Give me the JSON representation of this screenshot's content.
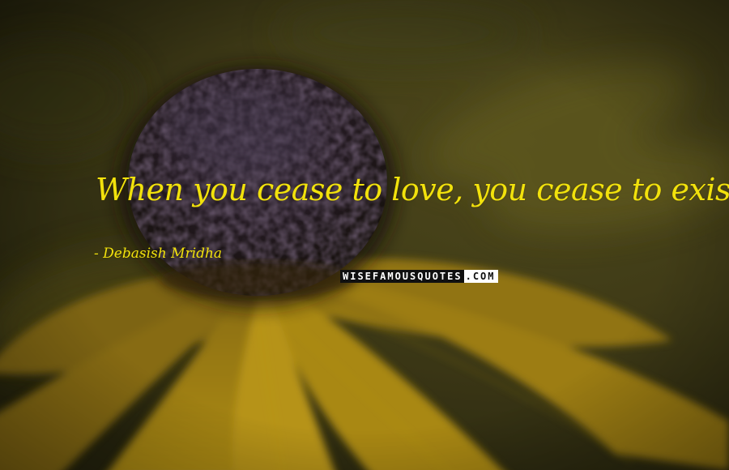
{
  "quote": {
    "text": "When you cease to love, you cease to exist.",
    "author": "- Debasish Mridha"
  },
  "watermark": {
    "brand": "WISEFAMOUSQUOTES",
    "suffix": ".COM"
  },
  "background": {
    "subject": "yellow flower with dark center",
    "colors": {
      "petal": "#c7a117",
      "petal_shadow": "#8a6d10",
      "center": "#2a1f2a",
      "bokeh": "#4d4a18"
    }
  },
  "colors": {
    "quote_text": "#f2e20c",
    "author_text": "#f2e20c",
    "watermark_dark_bg": "#101010",
    "watermark_dark_fg": "#ffffff",
    "watermark_light_bg": "#ffffff",
    "watermark_light_fg": "#101010"
  }
}
